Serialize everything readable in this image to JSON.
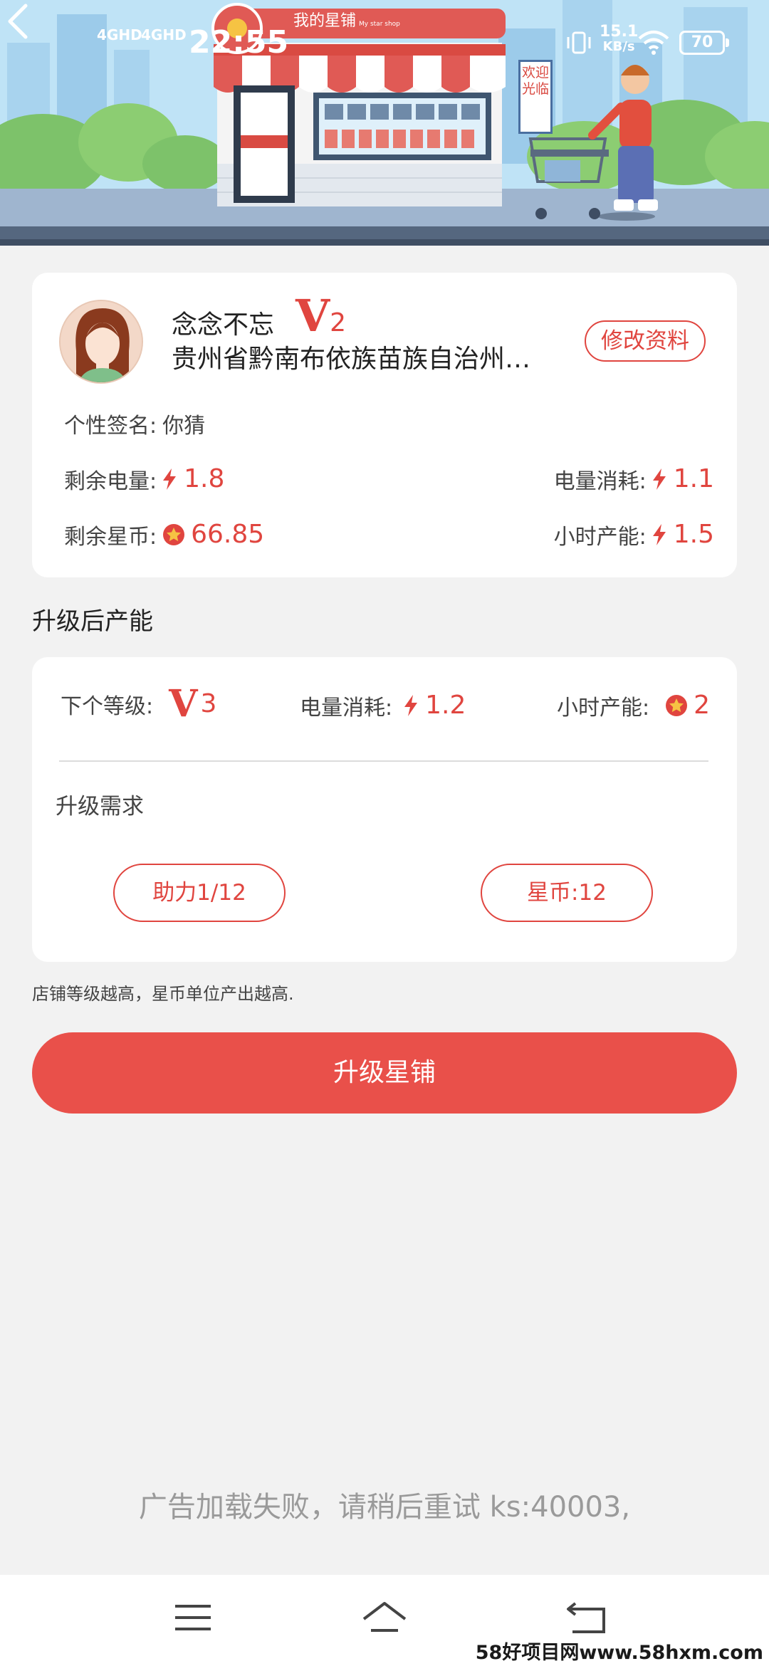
{
  "status_bar": {
    "signal1": "4GHD",
    "signal2": "4GHD",
    "time": "22:55",
    "speed_value": "15.1",
    "speed_unit": "KB/s",
    "battery": "70"
  },
  "header": {
    "shop_title": "我的星铺",
    "shop_subtitle": "My star shop",
    "welcome_sign": "欢迎光临"
  },
  "profile": {
    "nickname": "念念不忘",
    "level_letter": "V",
    "level_number": "2",
    "location": "贵州省黔南布依族苗族自治州…",
    "edit_label": "修改资料",
    "signature_label": "个性签名:",
    "signature_value": "你猜",
    "remaining_power_label": "剩余电量:",
    "remaining_power_value": "1.8",
    "power_consumption_label": "电量消耗:",
    "power_consumption_value": "1.1",
    "remaining_coins_label": "剩余星币:",
    "remaining_coins_value": "66.85",
    "hourly_output_label": "小时产能:",
    "hourly_output_value": "1.5"
  },
  "upgrade": {
    "section_title": "升级后产能",
    "next_level_label": "下个等级:",
    "next_level_letter": "V",
    "next_level_number": "3",
    "power_consumption_label": "电量消耗:",
    "power_consumption_value": "1.2",
    "hourly_output_label": "小时产能:",
    "hourly_output_value": "2",
    "requirements_title": "升级需求",
    "req_assist": "助力1/12",
    "req_coins": "星币:12"
  },
  "note": "店铺等级越高，星币单位产出越高.",
  "upgrade_button": "升级星铺",
  "ad_message": "广告加载失败，请稍后重试 ks:40003,",
  "watermark": "58好项目网www.58hxm.com",
  "colors": {
    "accent": "#e0453f",
    "button": "#e9504a",
    "background": "#f2f2f2"
  }
}
